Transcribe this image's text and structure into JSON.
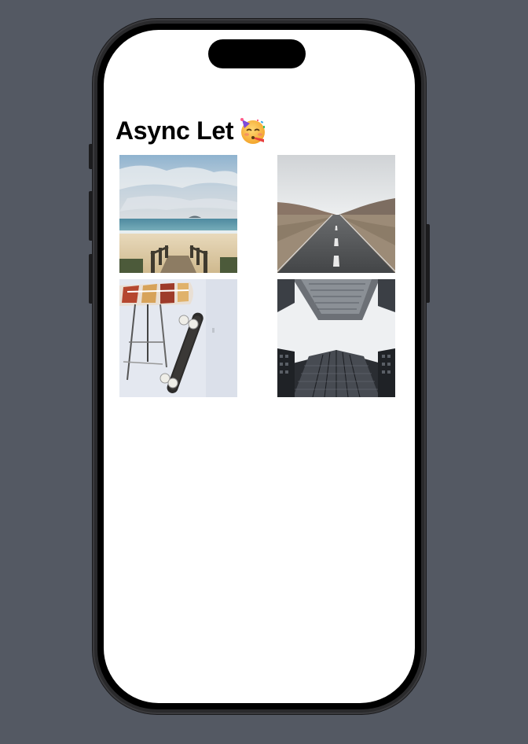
{
  "screen": {
    "title": "Async Let",
    "title_emoji": "partying-face-icon"
  },
  "photos": [
    {
      "name": "beach-stairs-photo",
      "description_icon": "beach-photo"
    },
    {
      "name": "desert-road-photo",
      "description_icon": "road-photo"
    },
    {
      "name": "skateboard-photo",
      "description_icon": "skateboard-photo"
    },
    {
      "name": "skyscrapers-photo",
      "description_icon": "buildings-photo"
    }
  ],
  "colors": {
    "background": "#545963",
    "screen": "#ffffff",
    "title": "#000000"
  }
}
